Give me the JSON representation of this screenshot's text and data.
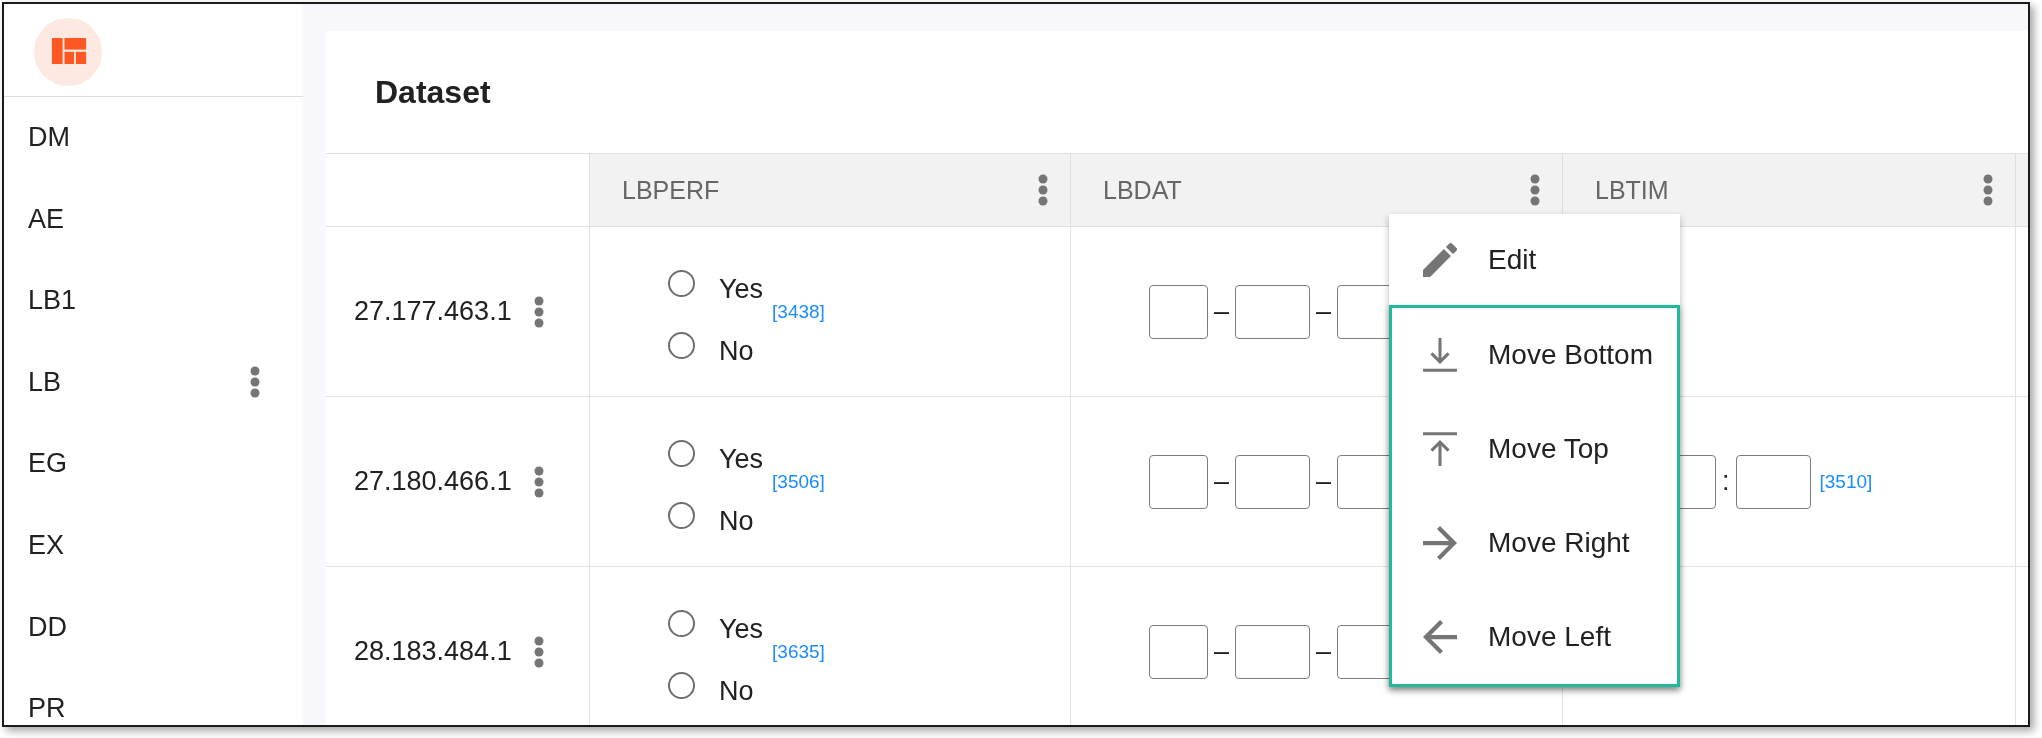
{
  "sidebar": {
    "items": [
      {
        "label": "DM",
        "has_menu": false
      },
      {
        "label": "AE",
        "has_menu": false
      },
      {
        "label": "LB1",
        "has_menu": false
      },
      {
        "label": "LB",
        "has_menu": true
      },
      {
        "label": "EG",
        "has_menu": false
      },
      {
        "label": "EX",
        "has_menu": false
      },
      {
        "label": "DD",
        "has_menu": false
      },
      {
        "label": "PR",
        "has_menu": false
      }
    ]
  },
  "page": {
    "title": "Dataset"
  },
  "table": {
    "columns": [
      {
        "label": "LBPERF"
      },
      {
        "label": "LBDAT"
      },
      {
        "label": "LBTIM"
      }
    ],
    "rows": [
      {
        "label": "27.177.463.1",
        "cells": [
          {
            "kind": "radio",
            "options": [
              {
                "label": "Yes",
                "selected": false
              },
              {
                "label": "No",
                "selected": false
              }
            ],
            "ref": "[3438]"
          },
          {
            "kind": "inputs",
            "parts": [
              {
                "kind": "field",
                "wide": false
              },
              {
                "kind": "separator",
                "text": "–"
              },
              {
                "kind": "field",
                "wide": true
              },
              {
                "kind": "separator",
                "text": "–"
              },
              {
                "kind": "field",
                "wide": true
              }
            ]
          }
        ]
      },
      {
        "label": "27.180.466.1",
        "cells": [
          {
            "kind": "radio",
            "options": [
              {
                "label": "Yes",
                "selected": false
              },
              {
                "label": "No",
                "selected": false
              }
            ],
            "ref": "[3506]"
          },
          {
            "kind": "inputs",
            "parts": [
              {
                "kind": "field",
                "wide": false
              },
              {
                "kind": "separator",
                "text": "–"
              },
              {
                "kind": "field",
                "wide": true
              },
              {
                "kind": "separator",
                "text": "–"
              },
              {
                "kind": "field",
                "wide": true
              }
            ]
          },
          {
            "kind": "inputs",
            "parts": [
              {
                "kind": "field",
                "wide": true
              },
              {
                "kind": "separator",
                "text": ":"
              },
              {
                "kind": "field",
                "wide": true
              }
            ],
            "ref": "[3510]"
          }
        ]
      },
      {
        "label": "28.183.484.1",
        "cells": [
          {
            "kind": "radio",
            "options": [
              {
                "label": "Yes",
                "selected": false
              },
              {
                "label": "No",
                "selected": false
              }
            ],
            "ref": "[3635]"
          },
          {
            "kind": "inputs",
            "parts": [
              {
                "kind": "field",
                "wide": false
              },
              {
                "kind": "separator",
                "text": "–"
              },
              {
                "kind": "field",
                "wide": true
              },
              {
                "kind": "separator",
                "text": "–"
              },
              {
                "kind": "field",
                "wide": true
              }
            ]
          }
        ]
      }
    ]
  },
  "context_menu": {
    "items": [
      {
        "label": "Edit",
        "kind": "edit",
        "highlighted": false
      },
      {
        "label": "Move Bottom",
        "kind": "bottom",
        "highlighted": true
      },
      {
        "label": "Move Top",
        "kind": "top",
        "highlighted": true
      },
      {
        "label": "Move Right",
        "kind": "right",
        "highlighted": true
      },
      {
        "label": "Move Left",
        "kind": "left",
        "highlighted": true
      }
    ]
  }
}
